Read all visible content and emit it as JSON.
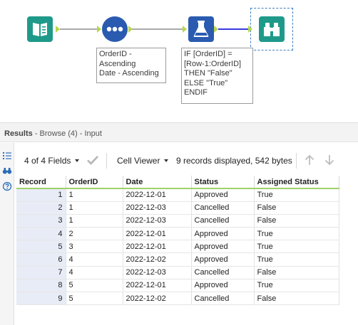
{
  "workflow": {
    "annotations": {
      "sort": "OrderID -\nAscending\nDate - Ascending",
      "formula": "IF [OrderID] =\n[Row-1:OrderID]\nTHEN \"False\"\nELSE \"True\"\nENDIF"
    },
    "tools": {
      "input": {
        "icon": "book-input-icon",
        "color": "#1f9a8a"
      },
      "sort": {
        "icon": "three-dots-icon",
        "color": "#2a5bb0"
      },
      "formula": {
        "icon": "flask-icon",
        "color": "#2a5bb0"
      },
      "browse": {
        "icon": "binoculars-icon",
        "color": "#1f9a8a"
      }
    },
    "accent_colors": {
      "anchor": "#b6d84a",
      "connection": "#a9a9a9",
      "selected_connection": "#3a3ae0"
    }
  },
  "results": {
    "title": "Results",
    "subtitle": "- Browse (4) - Input"
  },
  "toolbar": {
    "fields_label": "4 of 4 Fields",
    "viewer_label": "Cell Viewer",
    "records_info": "9 records displayed, 542 bytes"
  },
  "grid": {
    "columns": [
      "Record",
      "OrderID",
      "Date",
      "Status",
      "Assigned Status"
    ],
    "rows": [
      [
        "1",
        "1",
        "2022-12-01",
        "Approved",
        "True"
      ],
      [
        "2",
        "1",
        "2022-12-03",
        "Cancelled",
        "False"
      ],
      [
        "3",
        "1",
        "2022-12-03",
        "Cancelled",
        "False"
      ],
      [
        "4",
        "2",
        "2022-12-01",
        "Approved",
        "True"
      ],
      [
        "5",
        "3",
        "2022-12-01",
        "Approved",
        "True"
      ],
      [
        "6",
        "4",
        "2022-12-02",
        "Approved",
        "True"
      ],
      [
        "7",
        "4",
        "2022-12-03",
        "Cancelled",
        "False"
      ],
      [
        "8",
        "5",
        "2022-12-01",
        "Approved",
        "True"
      ],
      [
        "9",
        "5",
        "2022-12-02",
        "Cancelled",
        "False"
      ]
    ],
    "header_underline_color": "#9ed06a",
    "record_column_color": "#e7ecf6"
  }
}
